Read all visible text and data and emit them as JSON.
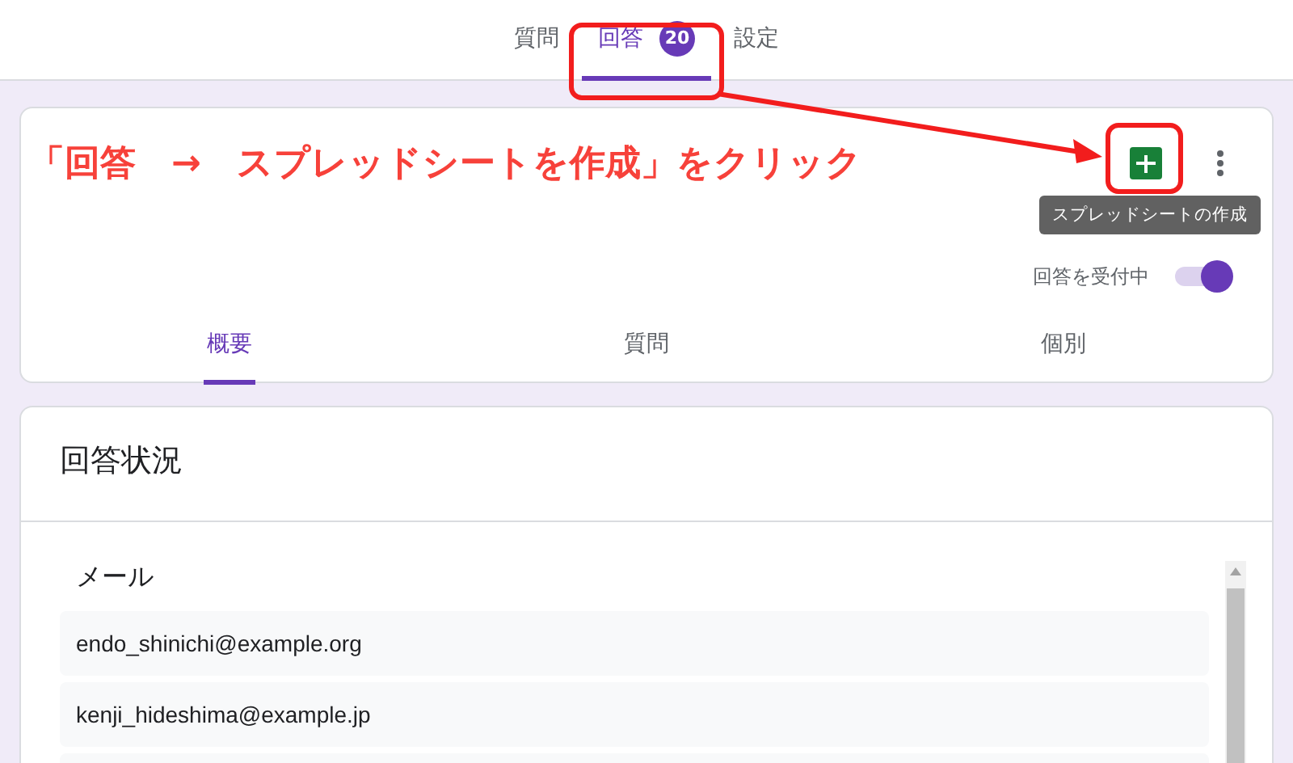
{
  "top_tabs": [
    {
      "label": "質問",
      "selected": false
    },
    {
      "label": "回答",
      "selected": true,
      "badge": "20"
    },
    {
      "label": "設定",
      "selected": false
    }
  ],
  "annotation": {
    "text": "「回答　→　スプレッドシートを作成」をクリック"
  },
  "header": {
    "tooltip": "スプレッドシートの作成",
    "accepting_label": "回答を受付中",
    "accepting": true
  },
  "summary_tabs": [
    {
      "label": "概要",
      "selected": true
    },
    {
      "label": "質問",
      "selected": false
    },
    {
      "label": "個別",
      "selected": false
    }
  ],
  "status": {
    "title": "回答状況",
    "question": "メール",
    "responses": [
      "endo_shinichi@example.org",
      "kenji_hideshima@example.jp"
    ]
  }
}
